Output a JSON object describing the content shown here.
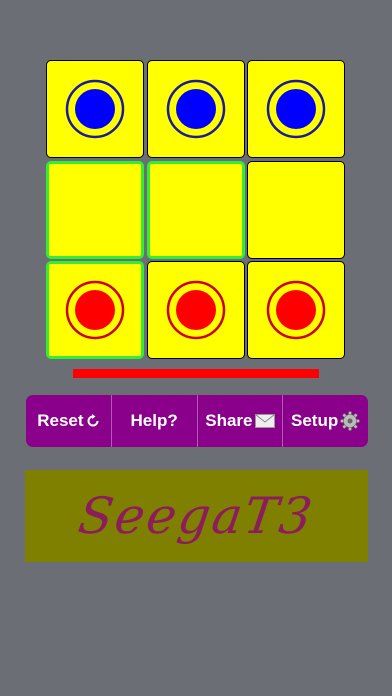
{
  "board": {
    "rows": [
      [
        {
          "piece": "blue",
          "highlight": false
        },
        {
          "piece": "blue",
          "highlight": false
        },
        {
          "piece": "blue",
          "highlight": false
        }
      ],
      [
        {
          "piece": null,
          "highlight": true
        },
        {
          "piece": null,
          "highlight": true
        },
        {
          "piece": null,
          "highlight": false
        }
      ],
      [
        {
          "piece": "red",
          "highlight": true
        },
        {
          "piece": "red",
          "highlight": false
        },
        {
          "piece": "red",
          "highlight": false
        }
      ]
    ]
  },
  "colors": {
    "background": "#6b6e74",
    "cell": "#ffff00",
    "highlight": "#33ee33",
    "blue_piece": "#0000ff",
    "blue_ring": "#1a1aa0",
    "red_piece": "#ff0000",
    "red_ring": "#cc0000",
    "turn_indicator": "#ff0000",
    "toolbar": "#8b008b",
    "banner": "#808000",
    "banner_text": "#8b1e5a"
  },
  "turn_indicator": {
    "player": "red"
  },
  "toolbar": {
    "reset_label": "Reset",
    "reset_icon": "refresh-icon",
    "help_label": "Help?",
    "share_label": "Share",
    "share_icon": "envelope-icon",
    "setup_label": "Setup",
    "setup_icon": "gear-icon"
  },
  "banner": {
    "title": "SeegaT3"
  }
}
